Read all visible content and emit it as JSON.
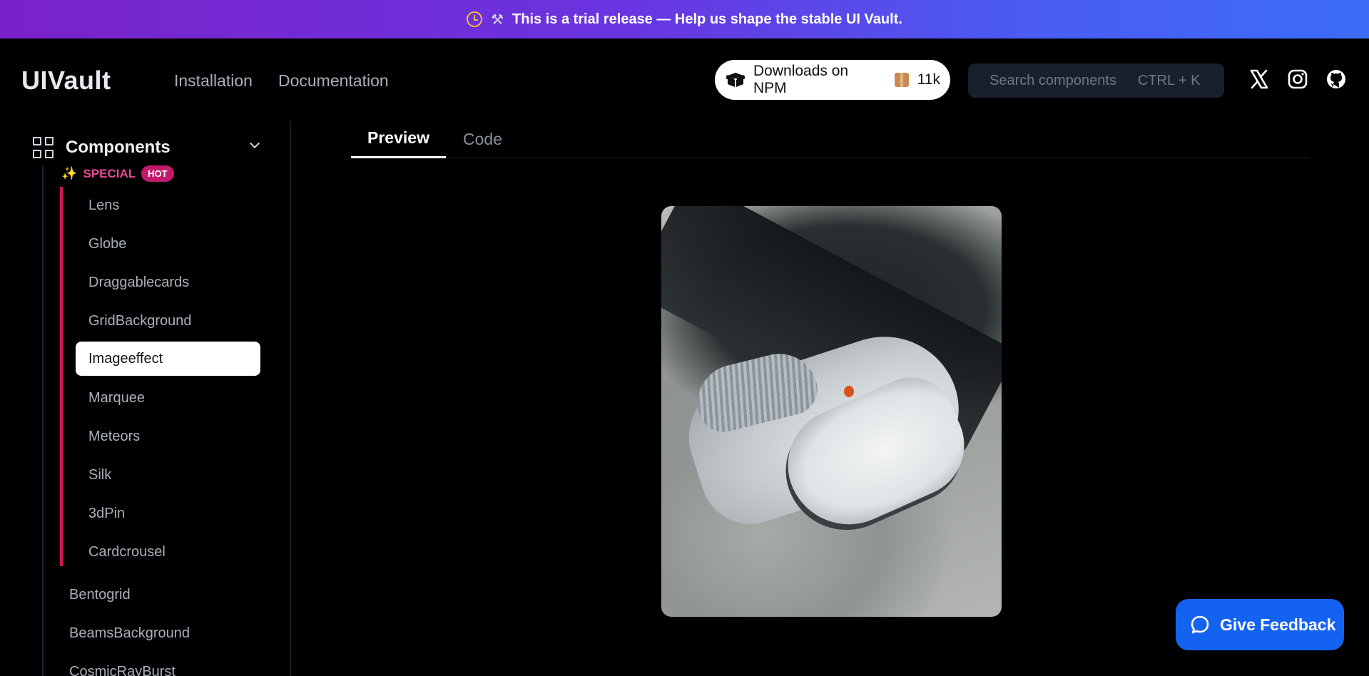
{
  "banner": {
    "text": "This is a trial release — Help us shape the stable UI Vault."
  },
  "header": {
    "logo": "UIVault",
    "nav": [
      "Installation",
      "Documentation"
    ],
    "npm": {
      "label": "Downloads on NPM",
      "count": "11k"
    },
    "search": {
      "placeholder": "Search components",
      "shortcut": "CTRL + K"
    },
    "social_icons": [
      "x-icon",
      "instagram-icon",
      "github-icon"
    ]
  },
  "sidebar": {
    "section_label": "Components",
    "special": {
      "label": "SPECIAL",
      "badge": "HOT"
    },
    "special_items": [
      "Lens",
      "Globe",
      "Draggablecards",
      "GridBackground",
      "Imageeffect",
      "Marquee",
      "Meteors",
      "Silk",
      "3dPin",
      "Cardcrousel"
    ],
    "active_item": "Imageeffect",
    "items": [
      "Bentogrid",
      "BeamsBackground",
      "CosmicRayBurst"
    ]
  },
  "main": {
    "tabs": [
      "Preview",
      "Code"
    ],
    "active_tab": "Preview"
  },
  "feedback": {
    "label": "Give Feedback"
  },
  "colors": {
    "accent_pink": "#ec4899",
    "hot_badge": "#c21a6b",
    "feedback_blue": "#1463f0",
    "banner_start": "#7a22c9",
    "banner_end": "#3d6cf8"
  }
}
